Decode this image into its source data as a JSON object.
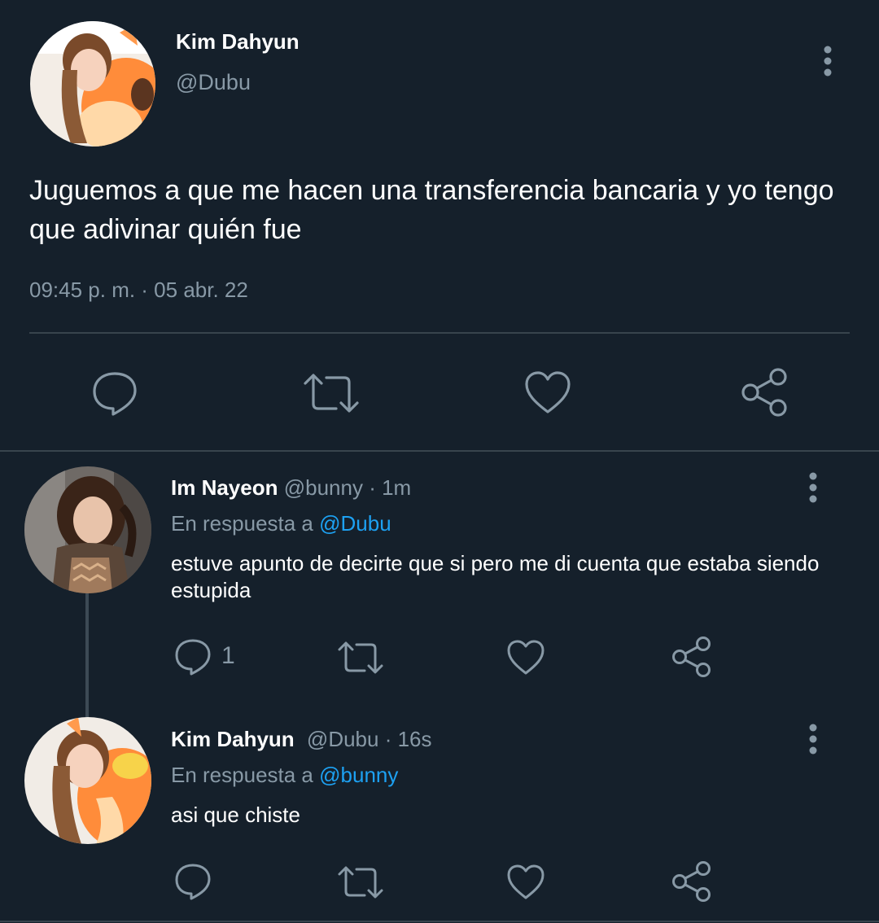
{
  "main_tweet": {
    "author": {
      "name": "Kim Dahyun",
      "handle": "@Dubu"
    },
    "text": "Juguemos a que me hacen una transferencia bancaria y yo tengo que adivinar quién fue",
    "timestamp": "09:45 p. m. · 05 abr. 22",
    "icons": [
      "reply-icon",
      "retweet-icon",
      "like-icon",
      "share-icon"
    ]
  },
  "replies": [
    {
      "author": {
        "name": "Im Nayeon",
        "handle": "@bunny"
      },
      "time": "· 1m",
      "reply_prefix": "En respuesta a",
      "reply_to": "@Dubu",
      "text": "estuve apunto de decirte que si pero me di cuenta que estaba siendo estupida",
      "reply_count": "1"
    },
    {
      "author": {
        "name": "Kim Dahyun",
        "handle": "@Dubu"
      },
      "time": "· 16s",
      "reply_prefix": "En respuesta a",
      "reply_to": "@bunny",
      "text": "asi que chiste",
      "reply_count": ""
    }
  ],
  "colors": {
    "background": "#15202b",
    "muted": "#8899a6",
    "link": "#1da1f2",
    "divider": "#38444d"
  }
}
